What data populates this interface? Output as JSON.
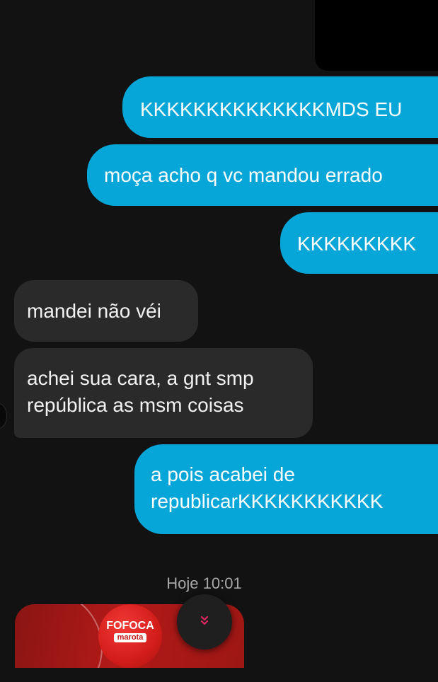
{
  "messages": [
    {
      "direction": "outgoing",
      "lines": [
        "KKKKKKKKKKKKKKMDS EU"
      ]
    },
    {
      "direction": "outgoing",
      "lines": [
        "moça acho q vc mandou errado"
      ]
    },
    {
      "direction": "outgoing",
      "lines": [
        "KKKKKKKKK"
      ]
    },
    {
      "direction": "incoming",
      "lines": [
        "mandei não véi"
      ]
    },
    {
      "direction": "incoming",
      "lines": [
        "achei sua cara, a gnt smp",
        "república as msm coisas"
      ]
    },
    {
      "direction": "outgoing",
      "lines": [
        "a pois acabei de",
        "republicarKKKKKKKKKKK"
      ]
    }
  ],
  "timestamp": "Hoje 10:01",
  "shared_preview": {
    "logo_line1": "FOFOCA",
    "logo_line2": "marota"
  },
  "scroll_button": {
    "icon": "double-chevron-down-icon",
    "color": "#e0245e"
  },
  "colors": {
    "outgoing_bubble": "#06a6d9",
    "incoming_bubble": "#2a2a2a",
    "background": "#121212"
  }
}
